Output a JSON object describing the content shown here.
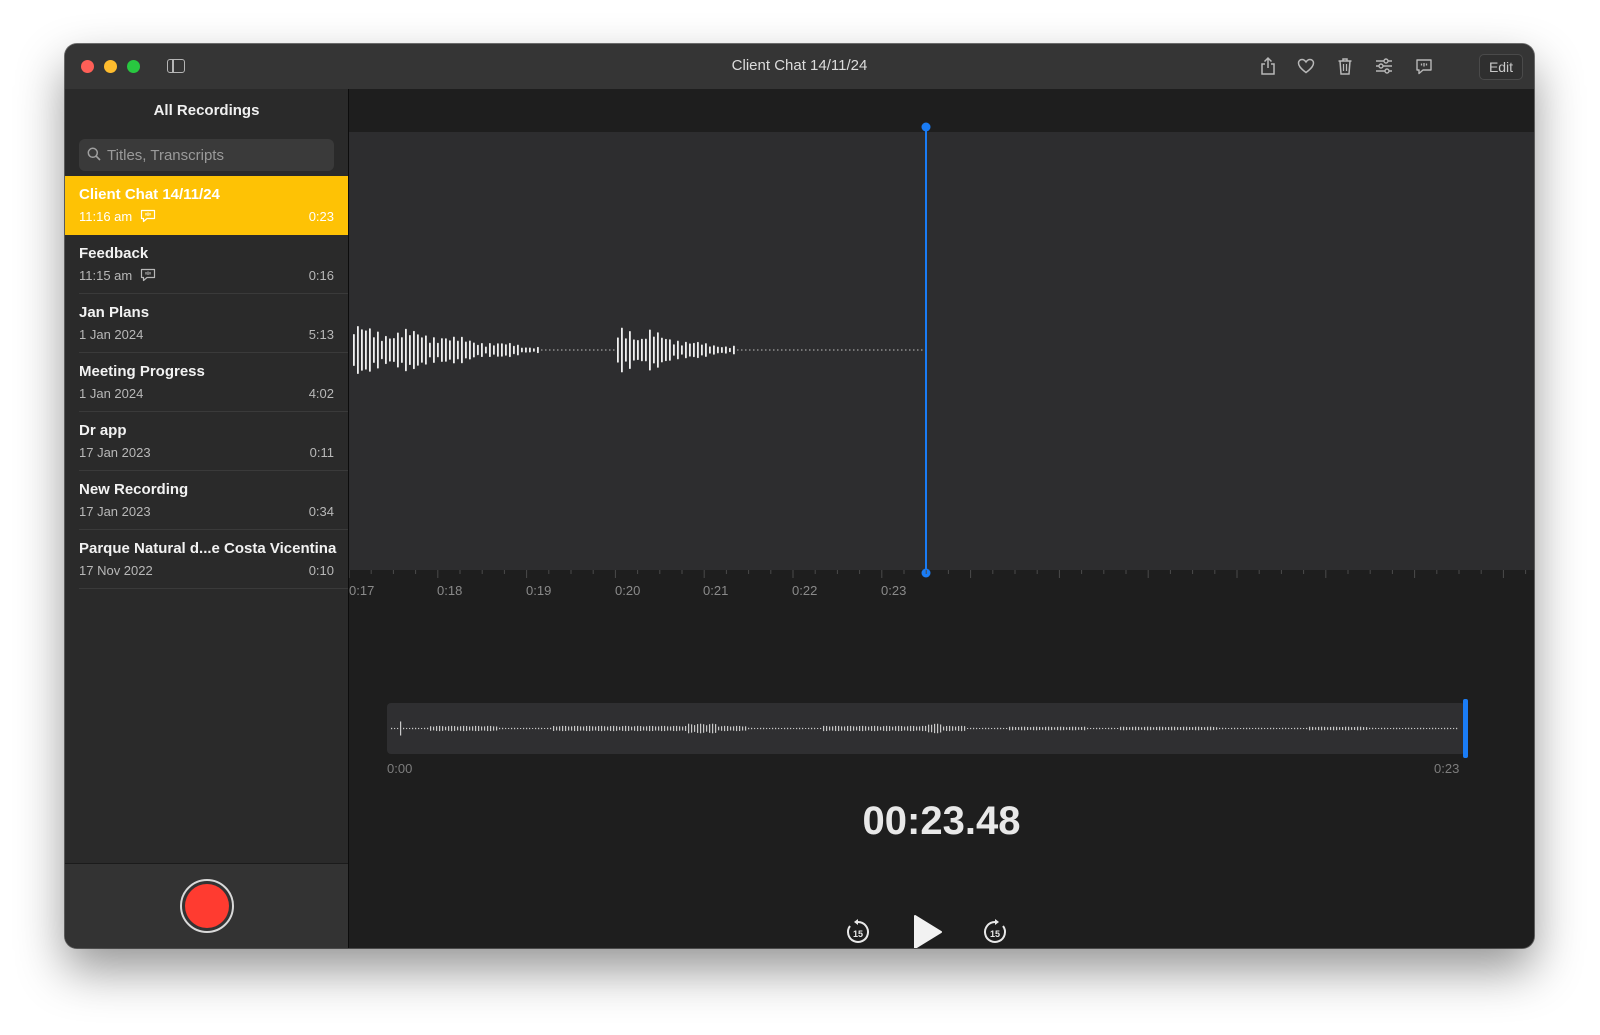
{
  "window": {
    "title": "Client Chat 14/11/24",
    "edit_label": "Edit",
    "toolbar_icons": [
      "share-icon",
      "heart-icon",
      "trash-icon",
      "sliders-icon",
      "transcript-icon"
    ]
  },
  "sidebar": {
    "title": "All Recordings",
    "search_placeholder": "Titles, Transcripts",
    "recordings": [
      {
        "title": "Client Chat 14/11/24",
        "date": "11:16 am",
        "duration": "0:23",
        "has_transcript": true,
        "selected": true
      },
      {
        "title": "Feedback",
        "date": "11:15 am",
        "duration": "0:16",
        "has_transcript": true,
        "selected": false
      },
      {
        "title": "Jan Plans",
        "date": "1 Jan 2024",
        "duration": "5:13",
        "has_transcript": false,
        "selected": false
      },
      {
        "title": "Meeting Progress",
        "date": "1 Jan 2024",
        "duration": "4:02",
        "has_transcript": false,
        "selected": false
      },
      {
        "title": "Dr app",
        "date": "17 Jan 2023",
        "duration": "0:11",
        "has_transcript": false,
        "selected": false
      },
      {
        "title": "New Recording",
        "date": "17 Jan 2023",
        "duration": "0:34",
        "has_transcript": false,
        "selected": false
      },
      {
        "title": "Parque Natural d...e Costa Vicentina",
        "date": "17 Nov 2022",
        "duration": "0:10",
        "has_transcript": false,
        "selected": false
      }
    ]
  },
  "player": {
    "timeline_ticks": [
      "0:17",
      "0:18",
      "0:19",
      "0:20",
      "0:21",
      "0:22",
      "0:23"
    ],
    "overview_start": "0:00",
    "overview_end": "0:23",
    "current_time": "00:23.48",
    "playhead_fraction": 1.0,
    "skip_back_label": "15",
    "skip_forward_label": "15"
  },
  "colors": {
    "accent_yellow": "#fec205",
    "playhead_blue": "#1a7cf5",
    "record_red": "#ff3b30"
  }
}
